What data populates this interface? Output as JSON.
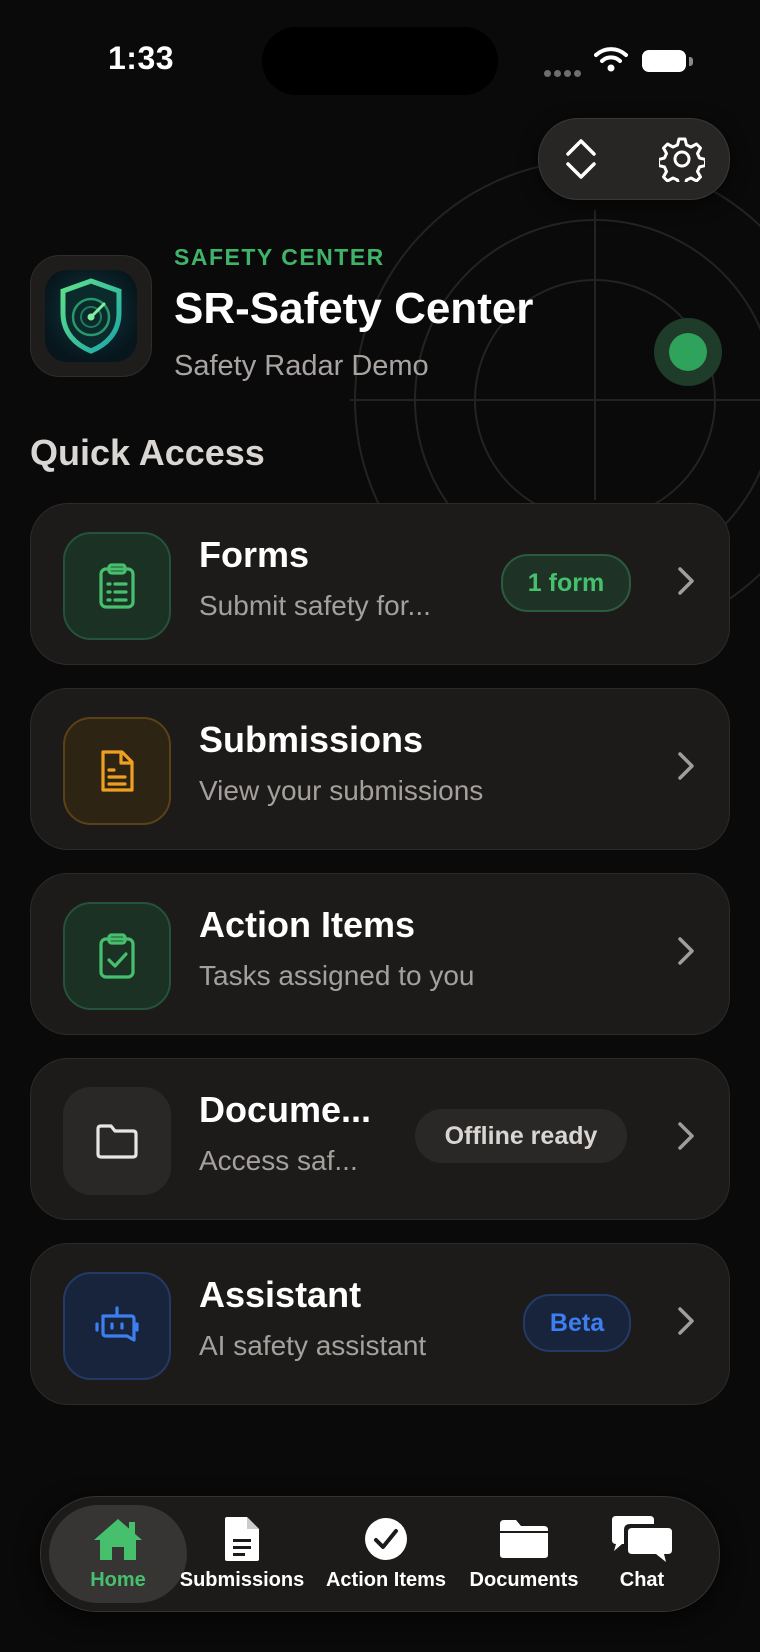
{
  "status_bar": {
    "time": "1:33"
  },
  "header": {
    "eyebrow": "SAFETY CENTER",
    "title": "SR-Safety Center",
    "subtitle": "Safety Radar Demo"
  },
  "section_title": "Quick Access",
  "cards": [
    {
      "title": "Forms",
      "subtitle": "Submit safety for...",
      "badge": "1 form",
      "icon": "clipboard-list-icon",
      "accent": "#46c06d"
    },
    {
      "title": "Submissions",
      "subtitle": "View your submissions",
      "badge": "",
      "icon": "document-icon",
      "accent": "#f0a020"
    },
    {
      "title": "Action Items",
      "subtitle": "Tasks assigned to you",
      "badge": "",
      "icon": "clipboard-check-icon",
      "accent": "#46c06d"
    },
    {
      "title": "Docume...",
      "subtitle": "Access saf...",
      "badge": "Offline ready",
      "icon": "folder-icon",
      "accent": "#e8e6e3"
    },
    {
      "title": "Assistant",
      "subtitle": "AI safety assistant",
      "badge": "Beta",
      "icon": "robot-icon",
      "accent": "#3d7ff0"
    }
  ],
  "tabs": [
    {
      "label": "Home",
      "icon": "house-icon",
      "active": true
    },
    {
      "label": "Submissions",
      "icon": "document-icon",
      "active": false
    },
    {
      "label": "Action Items",
      "icon": "checkmark-circle-icon",
      "active": false
    },
    {
      "label": "Documents",
      "icon": "folder-icon",
      "active": false
    },
    {
      "label": "Chat",
      "icon": "chat-bubbles-icon",
      "active": false
    }
  ],
  "colors": {
    "background": "#0b0a0a",
    "card": "#1d1b1a",
    "accent_green": "#46c06d",
    "accent_orange": "#f0a020",
    "accent_blue": "#3d7ff0"
  }
}
